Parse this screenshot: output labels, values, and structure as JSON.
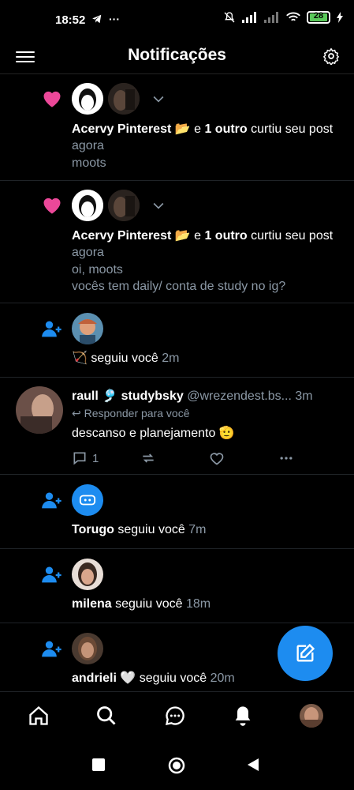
{
  "status_bar": {
    "time": "18:52",
    "battery": "28"
  },
  "header": {
    "title": "Notificações"
  },
  "notifications": [
    {
      "type": "like",
      "actor": "Acervy Pinterest 📂",
      "connector": " e ",
      "others": "1 outro",
      "action": " curtiu seu post ",
      "time": "agora",
      "content": [
        "moots"
      ]
    },
    {
      "type": "like",
      "actor": "Acervy Pinterest 📂",
      "connector": " e ",
      "others": "1 outro",
      "action": " curtiu seu post ",
      "time": "agora",
      "content": [
        "oi, moots",
        "vocês tem daily/ conta de study no ig?"
      ]
    },
    {
      "type": "follow",
      "actor": "🏹",
      "action": " seguiu você ",
      "time": "2m"
    },
    {
      "type": "follow",
      "actor": "Torugo",
      "action": " seguiu você ",
      "time": "7m"
    },
    {
      "type": "follow",
      "actor": "milena",
      "action": " seguiu você ",
      "time": "18m"
    },
    {
      "type": "follow",
      "actor": "andrieli 🤍",
      "action": " seguiu você ",
      "time": "20m"
    }
  ],
  "post": {
    "author": "raull 🎐 studybsky",
    "handle": "@wrezendest.bs...",
    "time": "3m",
    "reply_label": "Responder para você",
    "text": "descanso e planejamento 🫡",
    "reply_count": "1"
  },
  "colors": {
    "accent": "#1d8cf0",
    "heart": "#ec4899",
    "muted": "#8b98a5"
  },
  "icons": {
    "like": "heart-icon",
    "follow": "person-add-icon",
    "compose": "pencil-icon"
  }
}
